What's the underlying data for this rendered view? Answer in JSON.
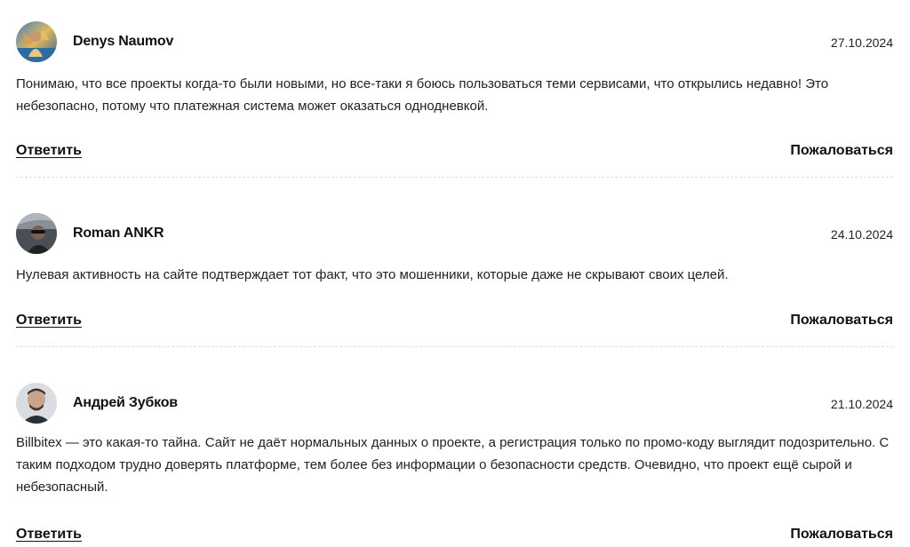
{
  "comments": [
    {
      "author": "Denys Naumov",
      "date": "27.10.2024",
      "text": "Понимаю, что все проекты когда-то были новыми, но все-таки я боюсь пользоваться теми сервисами, что открылись недавно! Это небезопасно, потому что платежная система может оказаться однодневкой.",
      "reply_label": "Ответить",
      "report_label": "Пожаловаться",
      "avatar": "avatar-photo-person-outdoors"
    },
    {
      "author": "Roman ANKR",
      "date": "24.10.2024",
      "text": "Нулевая активность на сайте подтверждает тот факт, что это мошенники, которые даже не скрывают своих целей.",
      "reply_label": "Ответить",
      "report_label": "Пожаловаться",
      "avatar": "avatar-photo-person-in-car"
    },
    {
      "author": "Андрей Зубков",
      "date": "21.10.2024",
      "text": "Billbitex — это какая-то тайна. Сайт не даёт нормальных данных о проекте, а регистрация только по промо-коду выглядит подозрительно. С таким подходом трудно доверять платформе, тем более без информации о безопасности средств. Очевидно, что проект ещё сырой и небезопасный.",
      "reply_label": "Ответить",
      "report_label": "Пожаловаться",
      "avatar": "avatar-photo-man-portrait"
    }
  ]
}
